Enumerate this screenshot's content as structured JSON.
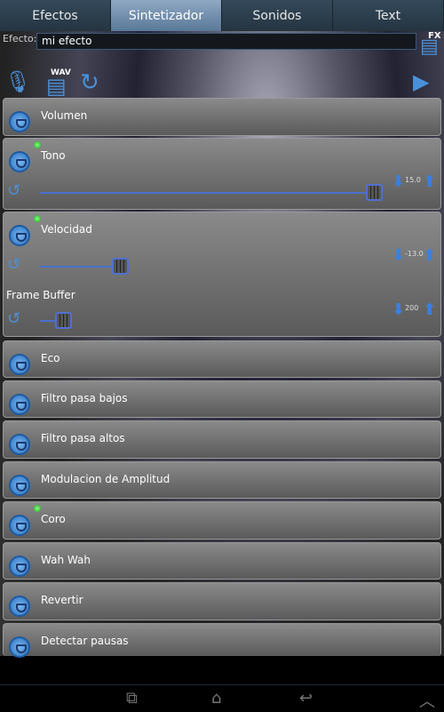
{
  "tabs": [
    {
      "label": "Efectos"
    },
    {
      "label": "Sintetizador",
      "active": true
    },
    {
      "label": "Sonidos"
    },
    {
      "label": "Text"
    }
  ],
  "effect": {
    "label": "Efecto:",
    "value": "mi efecto",
    "save_fx_label": "FX",
    "save_wav_label": "WAV"
  },
  "rows": [
    {
      "label": "Volumen"
    },
    {
      "label": "Tono",
      "active": true,
      "value": "15.0",
      "level": 1.0
    },
    {
      "label": "Velocidad",
      "active": true,
      "value": "-13.0",
      "level": 0.24,
      "sub_label": "Frame Buffer",
      "sub_value": "200",
      "sub_level": 0.07
    },
    {
      "label": "Eco"
    },
    {
      "label": "Filtro pasa bajos"
    },
    {
      "label": "Filtro pasa altos"
    },
    {
      "label": "Modulacion de Amplitud"
    },
    {
      "label": "Coro",
      "active": true
    },
    {
      "label": "Wah Wah"
    },
    {
      "label": "Revertir"
    },
    {
      "label": "Detectar pausas"
    }
  ],
  "colors": {
    "accent": "#4a90d8",
    "active_dot": "#22cc22",
    "tab_active": "#7a96b6"
  }
}
